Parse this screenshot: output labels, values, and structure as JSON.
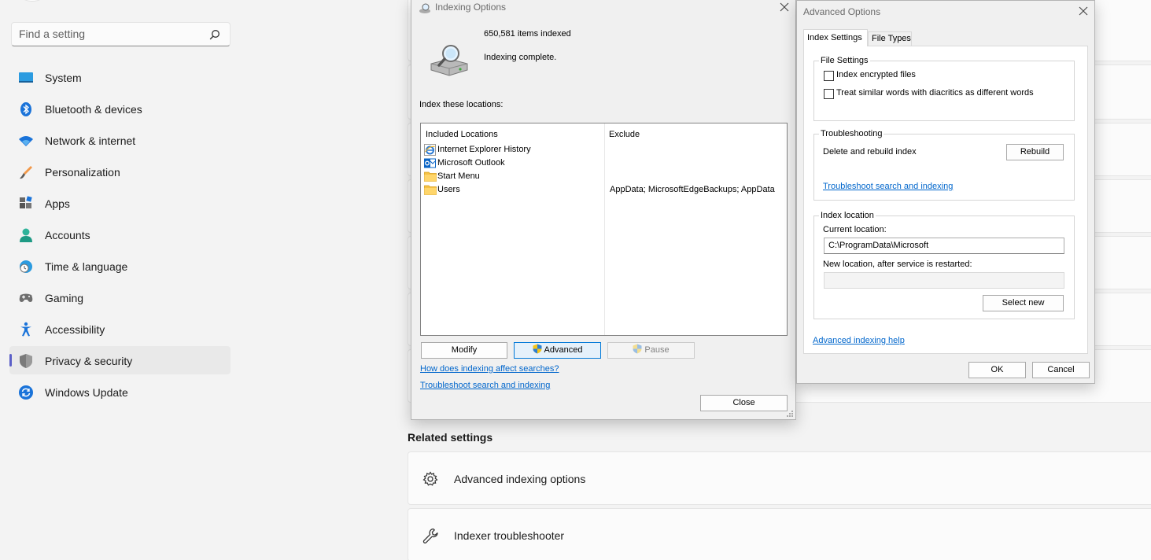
{
  "settings": {
    "search": {
      "placeholder": "Find a setting"
    },
    "nav": [
      {
        "label": "System",
        "icon": "system-icon"
      },
      {
        "label": "Bluetooth & devices",
        "icon": "bluetooth-icon"
      },
      {
        "label": "Network & internet",
        "icon": "wifi-icon"
      },
      {
        "label": "Personalization",
        "icon": "brush-icon"
      },
      {
        "label": "Apps",
        "icon": "apps-icon"
      },
      {
        "label": "Accounts",
        "icon": "person-icon"
      },
      {
        "label": "Time & language",
        "icon": "globe-clock-icon"
      },
      {
        "label": "Gaming",
        "icon": "gamepad-icon"
      },
      {
        "label": "Accessibility",
        "icon": "accessibility-icon"
      },
      {
        "label": "Privacy & security",
        "icon": "shield-icon",
        "active": true
      },
      {
        "label": "Windows Update",
        "icon": "sync-icon"
      }
    ],
    "related": {
      "title": "Related settings",
      "items": [
        {
          "label": "Advanced indexing options",
          "icon": "gear-icon"
        },
        {
          "label": "Indexer troubleshooter",
          "icon": "wrench-icon"
        }
      ]
    }
  },
  "indexing_options": {
    "title": "Indexing Options",
    "items_indexed": "650,581 items indexed",
    "status": "Indexing complete.",
    "locations_label": "Index these locations:",
    "columns": {
      "included": "Included Locations",
      "exclude": "Exclude"
    },
    "locations": [
      {
        "name": "Internet Explorer History",
        "icon": "ie-icon",
        "exclude": ""
      },
      {
        "name": "Microsoft Outlook",
        "icon": "outlook-icon",
        "exclude": ""
      },
      {
        "name": "Start Menu",
        "icon": "folder-icon",
        "exclude": ""
      },
      {
        "name": "Users",
        "icon": "folder-icon",
        "exclude": "AppData; MicrosoftEdgeBackups; AppData"
      }
    ],
    "buttons": {
      "modify": "Modify",
      "advanced": "Advanced",
      "pause": "Pause",
      "close": "Close"
    },
    "links": {
      "how_affects": "How does indexing affect searches?",
      "troubleshoot": "Troubleshoot search and indexing"
    }
  },
  "advanced_options": {
    "title": "Advanced Options",
    "tabs": [
      {
        "label": "Index Settings",
        "active": true
      },
      {
        "label": "File Types"
      }
    ],
    "file_settings": {
      "title": "File Settings",
      "encrypt_label": "Index encrypted files",
      "encrypt_checked": false,
      "diacritics_label": "Treat similar words with diacritics as different words",
      "diacritics_checked": false
    },
    "troubleshooting": {
      "title": "Troubleshooting",
      "rebuild_label": "Delete and rebuild index",
      "rebuild_button": "Rebuild",
      "link": "Troubleshoot search and indexing"
    },
    "index_location": {
      "title": "Index location",
      "current_label": "Current location:",
      "current_value": "C:\\ProgramData\\Microsoft",
      "new_label": "New location, after service is restarted:",
      "new_value": "",
      "select_button": "Select new"
    },
    "help_link": "Advanced indexing help",
    "ok": "OK",
    "cancel": "Cancel"
  },
  "colors": {
    "accent": "#5b5fc7",
    "link": "#0066cc",
    "focus": "#0078d7"
  }
}
